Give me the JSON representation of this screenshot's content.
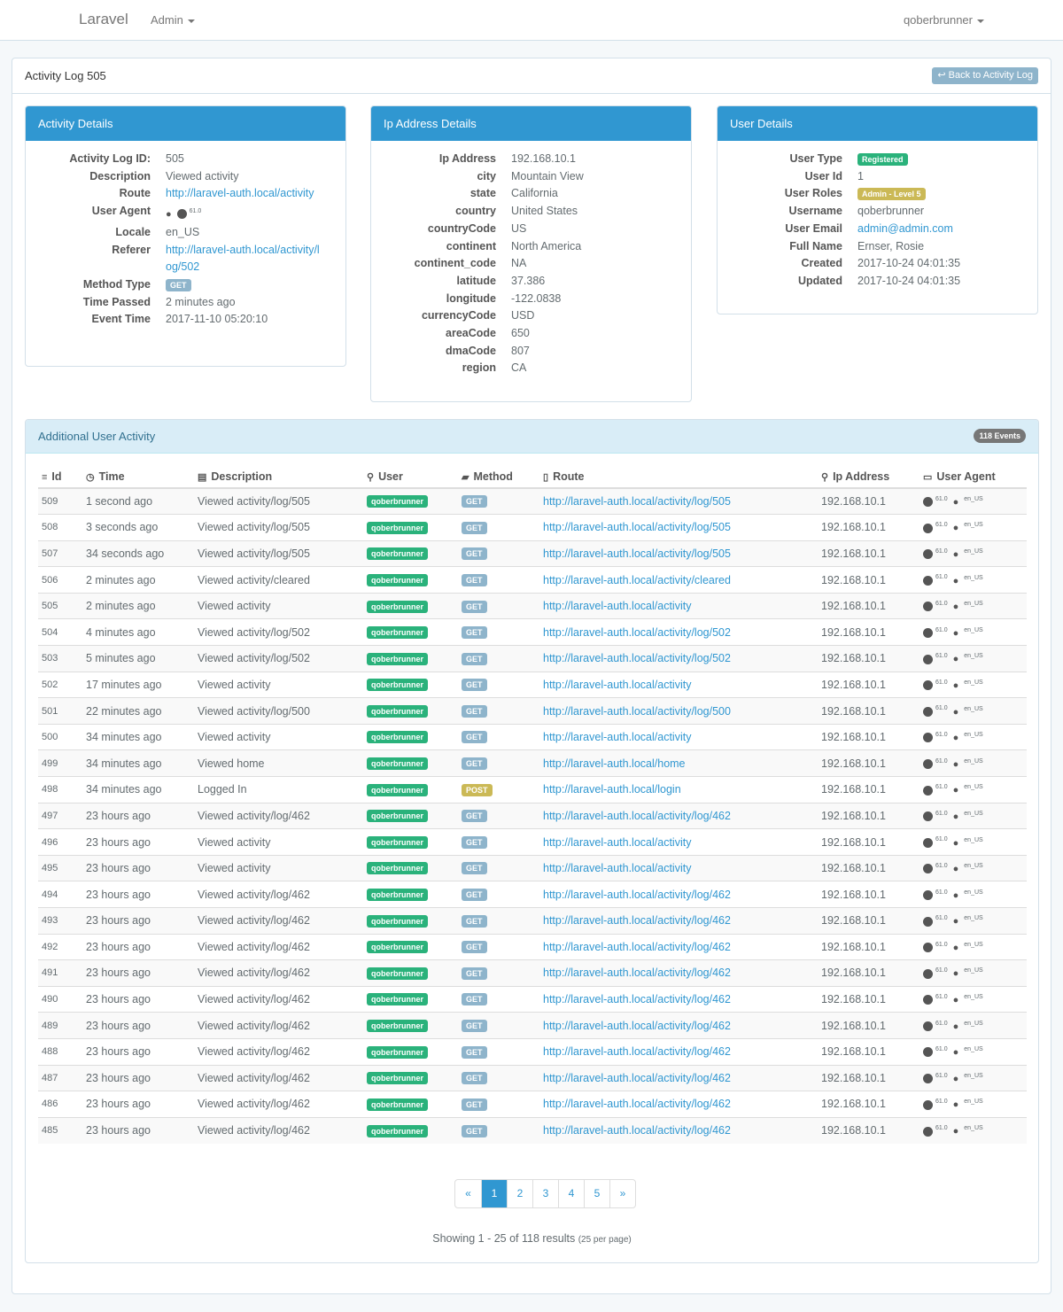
{
  "navbar": {
    "brand": "Laravel",
    "admin_menu": "Admin",
    "user_menu": "qoberbrunner"
  },
  "page": {
    "title": "Activity Log 505",
    "back_button": "Back to Activity Log"
  },
  "activity_details": {
    "header": "Activity Details",
    "rows": [
      {
        "label": "Activity Log ID:",
        "value": "505"
      },
      {
        "label": "Description",
        "value": "Viewed activity"
      },
      {
        "label": "Route",
        "value": "http://laravel-auth.local/activity",
        "link": true
      },
      {
        "label": "User Agent",
        "value": "",
        "agent_version": "61.0"
      },
      {
        "label": "Locale",
        "value": "en_US"
      },
      {
        "label": "Referer",
        "value": "http://laravel-auth.local/activity/log/502",
        "link": true
      },
      {
        "label": "Method Type",
        "value": "GET",
        "badge": true
      },
      {
        "label": "Time Passed",
        "value": "2 minutes ago"
      },
      {
        "label": "Event Time",
        "value": "2017-11-10 05:20:10"
      }
    ]
  },
  "ip_details": {
    "header": "Ip Address Details",
    "rows": [
      {
        "label": "Ip Address",
        "value": "192.168.10.1"
      },
      {
        "label": "city",
        "value": "Mountain View"
      },
      {
        "label": "state",
        "value": "California"
      },
      {
        "label": "country",
        "value": "United States"
      },
      {
        "label": "countryCode",
        "value": "US"
      },
      {
        "label": "continent",
        "value": "North America"
      },
      {
        "label": "continent_code",
        "value": "NA"
      },
      {
        "label": "latitude",
        "value": "37.386"
      },
      {
        "label": "longitude",
        "value": "-122.0838"
      },
      {
        "label": "currencyCode",
        "value": "USD"
      },
      {
        "label": "areaCode",
        "value": "650"
      },
      {
        "label": "dmaCode",
        "value": "807"
      },
      {
        "label": "region",
        "value": "CA"
      }
    ]
  },
  "user_details": {
    "header": "User Details",
    "rows": [
      {
        "label": "User Type",
        "value": "Registered",
        "badge": "green"
      },
      {
        "label": "User Id",
        "value": "1"
      },
      {
        "label": "User Roles",
        "value": "Admin - Level 5",
        "badge": "gold"
      },
      {
        "label": "Username",
        "value": "qoberbrunner"
      },
      {
        "label": "User Email",
        "value": "admin@admin.com",
        "link": true
      },
      {
        "label": "Full Name",
        "value": "Ernser, Rosie"
      },
      {
        "label": "Created",
        "value": "2017-10-24 04:01:35"
      },
      {
        "label": "Updated",
        "value": "2017-10-24 04:01:35"
      }
    ]
  },
  "activity": {
    "header": "Additional User Activity",
    "events_badge": "118 Events",
    "columns": [
      "Id",
      "Time",
      "Description",
      "User",
      "Method",
      "Route",
      "Ip Address",
      "User Agent"
    ],
    "rows": [
      {
        "id": "509",
        "time": "1 second ago",
        "desc": "Viewed activity/log/505",
        "user": "qoberbrunner",
        "method": "GET",
        "route": "http://laravel-auth.local/activity/log/505",
        "ip": "192.168.10.1",
        "ver": "61.0",
        "locale": "en_US"
      },
      {
        "id": "508",
        "time": "3 seconds ago",
        "desc": "Viewed activity/log/505",
        "user": "qoberbrunner",
        "method": "GET",
        "route": "http://laravel-auth.local/activity/log/505",
        "ip": "192.168.10.1",
        "ver": "61.0",
        "locale": "en_US"
      },
      {
        "id": "507",
        "time": "34 seconds ago",
        "desc": "Viewed activity/log/505",
        "user": "qoberbrunner",
        "method": "GET",
        "route": "http://laravel-auth.local/activity/log/505",
        "ip": "192.168.10.1",
        "ver": "61.0",
        "locale": "en_US"
      },
      {
        "id": "506",
        "time": "2 minutes ago",
        "desc": "Viewed activity/cleared",
        "user": "qoberbrunner",
        "method": "GET",
        "route": "http://laravel-auth.local/activity/cleared",
        "ip": "192.168.10.1",
        "ver": "61.0",
        "locale": "en_US"
      },
      {
        "id": "505",
        "time": "2 minutes ago",
        "desc": "Viewed activity",
        "user": "qoberbrunner",
        "method": "GET",
        "route": "http://laravel-auth.local/activity",
        "ip": "192.168.10.1",
        "ver": "61.0",
        "locale": "en_US"
      },
      {
        "id": "504",
        "time": "4 minutes ago",
        "desc": "Viewed activity/log/502",
        "user": "qoberbrunner",
        "method": "GET",
        "route": "http://laravel-auth.local/activity/log/502",
        "ip": "192.168.10.1",
        "ver": "61.0",
        "locale": "en_US"
      },
      {
        "id": "503",
        "time": "5 minutes ago",
        "desc": "Viewed activity/log/502",
        "user": "qoberbrunner",
        "method": "GET",
        "route": "http://laravel-auth.local/activity/log/502",
        "ip": "192.168.10.1",
        "ver": "61.0",
        "locale": "en_US"
      },
      {
        "id": "502",
        "time": "17 minutes ago",
        "desc": "Viewed activity",
        "user": "qoberbrunner",
        "method": "GET",
        "route": "http://laravel-auth.local/activity",
        "ip": "192.168.10.1",
        "ver": "61.0",
        "locale": "en_US"
      },
      {
        "id": "501",
        "time": "22 minutes ago",
        "desc": "Viewed activity/log/500",
        "user": "qoberbrunner",
        "method": "GET",
        "route": "http://laravel-auth.local/activity/log/500",
        "ip": "192.168.10.1",
        "ver": "61.0",
        "locale": "en_US"
      },
      {
        "id": "500",
        "time": "34 minutes ago",
        "desc": "Viewed activity",
        "user": "qoberbrunner",
        "method": "GET",
        "route": "http://laravel-auth.local/activity",
        "ip": "192.168.10.1",
        "ver": "61.0",
        "locale": "en_US"
      },
      {
        "id": "499",
        "time": "34 minutes ago",
        "desc": "Viewed home",
        "user": "qoberbrunner",
        "method": "GET",
        "route": "http://laravel-auth.local/home",
        "ip": "192.168.10.1",
        "ver": "61.0",
        "locale": "en_US"
      },
      {
        "id": "498",
        "time": "34 minutes ago",
        "desc": "Logged In",
        "user": "qoberbrunner",
        "method": "POST",
        "route": "http://laravel-auth.local/login",
        "ip": "192.168.10.1",
        "ver": "61.0",
        "locale": "en_US"
      },
      {
        "id": "497",
        "time": "23 hours ago",
        "desc": "Viewed activity/log/462",
        "user": "qoberbrunner",
        "method": "GET",
        "route": "http://laravel-auth.local/activity/log/462",
        "ip": "192.168.10.1",
        "ver": "61.0",
        "locale": "en_US"
      },
      {
        "id": "496",
        "time": "23 hours ago",
        "desc": "Viewed activity",
        "user": "qoberbrunner",
        "method": "GET",
        "route": "http://laravel-auth.local/activity",
        "ip": "192.168.10.1",
        "ver": "61.0",
        "locale": "en_US"
      },
      {
        "id": "495",
        "time": "23 hours ago",
        "desc": "Viewed activity",
        "user": "qoberbrunner",
        "method": "GET",
        "route": "http://laravel-auth.local/activity",
        "ip": "192.168.10.1",
        "ver": "61.0",
        "locale": "en_US"
      },
      {
        "id": "494",
        "time": "23 hours ago",
        "desc": "Viewed activity/log/462",
        "user": "qoberbrunner",
        "method": "GET",
        "route": "http://laravel-auth.local/activity/log/462",
        "ip": "192.168.10.1",
        "ver": "61.0",
        "locale": "en_US"
      },
      {
        "id": "493",
        "time": "23 hours ago",
        "desc": "Viewed activity/log/462",
        "user": "qoberbrunner",
        "method": "GET",
        "route": "http://laravel-auth.local/activity/log/462",
        "ip": "192.168.10.1",
        "ver": "61.0",
        "locale": "en_US"
      },
      {
        "id": "492",
        "time": "23 hours ago",
        "desc": "Viewed activity/log/462",
        "user": "qoberbrunner",
        "method": "GET",
        "route": "http://laravel-auth.local/activity/log/462",
        "ip": "192.168.10.1",
        "ver": "61.0",
        "locale": "en_US"
      },
      {
        "id": "491",
        "time": "23 hours ago",
        "desc": "Viewed activity/log/462",
        "user": "qoberbrunner",
        "method": "GET",
        "route": "http://laravel-auth.local/activity/log/462",
        "ip": "192.168.10.1",
        "ver": "61.0",
        "locale": "en_US"
      },
      {
        "id": "490",
        "time": "23 hours ago",
        "desc": "Viewed activity/log/462",
        "user": "qoberbrunner",
        "method": "GET",
        "route": "http://laravel-auth.local/activity/log/462",
        "ip": "192.168.10.1",
        "ver": "61.0",
        "locale": "en_US"
      },
      {
        "id": "489",
        "time": "23 hours ago",
        "desc": "Viewed activity/log/462",
        "user": "qoberbrunner",
        "method": "GET",
        "route": "http://laravel-auth.local/activity/log/462",
        "ip": "192.168.10.1",
        "ver": "61.0",
        "locale": "en_US"
      },
      {
        "id": "488",
        "time": "23 hours ago",
        "desc": "Viewed activity/log/462",
        "user": "qoberbrunner",
        "method": "GET",
        "route": "http://laravel-auth.local/activity/log/462",
        "ip": "192.168.10.1",
        "ver": "61.0",
        "locale": "en_US"
      },
      {
        "id": "487",
        "time": "23 hours ago",
        "desc": "Viewed activity/log/462",
        "user": "qoberbrunner",
        "method": "GET",
        "route": "http://laravel-auth.local/activity/log/462",
        "ip": "192.168.10.1",
        "ver": "61.0",
        "locale": "en_US"
      },
      {
        "id": "486",
        "time": "23 hours ago",
        "desc": "Viewed activity/log/462",
        "user": "qoberbrunner",
        "method": "GET",
        "route": "http://laravel-auth.local/activity/log/462",
        "ip": "192.168.10.1",
        "ver": "61.0",
        "locale": "en_US"
      },
      {
        "id": "485",
        "time": "23 hours ago",
        "desc": "Viewed activity/log/462",
        "user": "qoberbrunner",
        "method": "GET",
        "route": "http://laravel-auth.local/activity/log/462",
        "ip": "192.168.10.1",
        "ver": "61.0",
        "locale": "en_US"
      }
    ]
  },
  "pagination": {
    "prev": "«",
    "next": "»",
    "pages": [
      "1",
      "2",
      "3",
      "4",
      "5"
    ],
    "active": "1",
    "summary": "Showing 1 - 25 of 118 results",
    "per_page": "(25 per page)"
  },
  "colors": {
    "primary": "#3097d1",
    "success": "#2ab27b",
    "warning": "#cbb956",
    "info_bg": "#d9edf7"
  },
  "icons": [
    "database-icon",
    "clock-icon",
    "file-icon",
    "user-icon",
    "truck-icon",
    "map-icon",
    "map-marker-icon",
    "laptop-icon",
    "chrome-icon",
    "apple-icon",
    "reply-icon"
  ]
}
